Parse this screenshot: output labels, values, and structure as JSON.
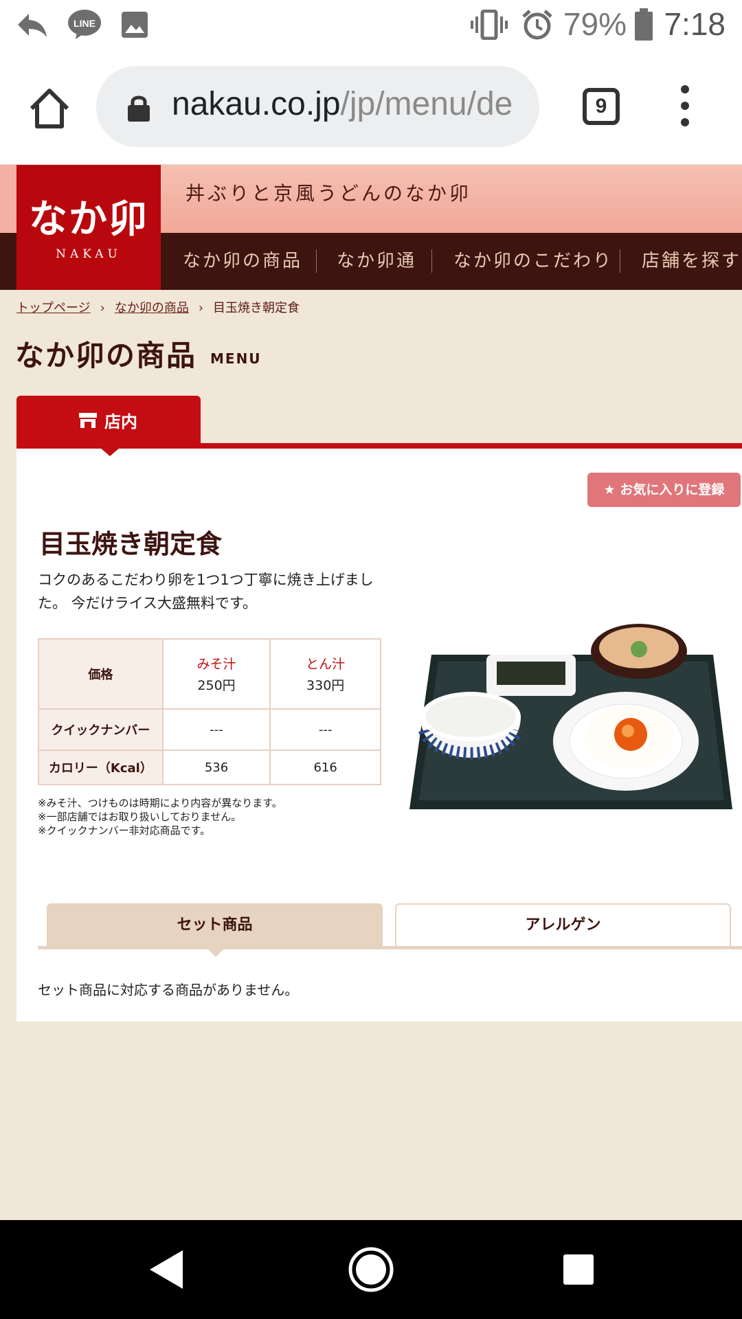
{
  "status_bar": {
    "battery_text": "79%",
    "time": "7:18",
    "icons": [
      "reply-icon",
      "line-app-icon",
      "image-icon",
      "vibrate-icon",
      "alarm-icon",
      "battery-icon"
    ]
  },
  "browser": {
    "url_host": "nakau.co.jp",
    "url_path": "/jp/menu/de",
    "tab_count": "9"
  },
  "site": {
    "logo_main": "なか卯",
    "logo_sub": "NAKAU",
    "tagline": "丼ぶりと京風うどんのなか卯",
    "nav": [
      "なか卯の商品",
      "なか卯通",
      "なか卯のこだわり",
      "店舗を探す"
    ]
  },
  "breadcrumb": {
    "items": [
      "トップページ",
      "なか卯の商品",
      "目玉焼き朝定食"
    ],
    "separator": "›"
  },
  "page": {
    "title": "なか卯の商品",
    "title_sub": "MENU"
  },
  "store_tab": {
    "label": "店内"
  },
  "product": {
    "favorite_label": "★ お気に入りに登録",
    "name": "目玉焼き朝定食",
    "description": "コクのあるこだわり卵を1つ1つ丁寧に焼き上げました。 今だけライス大盛無料です。",
    "table": {
      "price_header": "価格",
      "options": [
        {
          "name": "みそ汁",
          "price": "250円",
          "quick_number": "---",
          "calorie": "536"
        },
        {
          "name": "とん汁",
          "price": "330円",
          "quick_number": "---",
          "calorie": "616"
        }
      ],
      "quick_number_header": "クイックナンバー",
      "calorie_header": "カロリー（Kcal）"
    },
    "notes": [
      "※みそ汁、つけものは時期により内容が異なります。",
      "※一部店舗ではお取り扱いしておりません。",
      "※クイックナンバー非対応商品です。"
    ]
  },
  "sub_tabs": {
    "set_label": "セット商品",
    "allergy_label": "アレルゲン",
    "empty_message": "セット商品に対応する商品がありません。"
  },
  "colors": {
    "brand_red": "#c40d12",
    "header_dark": "#3d1410",
    "tagline_pink": "#f3b0a3",
    "favorite_pink": "#e0767a",
    "tab_beige": "#e6d3c0"
  }
}
